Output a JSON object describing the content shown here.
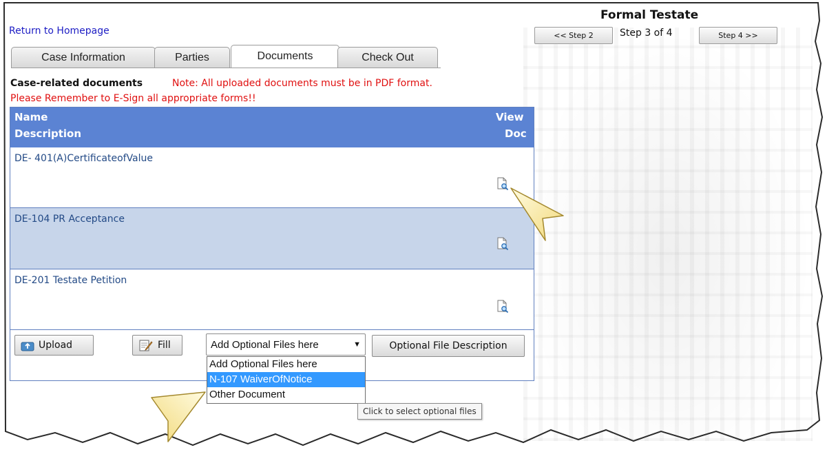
{
  "header": {
    "home_link": "Return to Homepage",
    "page_title": "Formal Testate",
    "prev_step": "<< Step 2",
    "step_indicator": "Step 3 of 4",
    "next_step": "Step 4 >>"
  },
  "tabs": [
    {
      "label": "Case Information"
    },
    {
      "label": "Parties"
    },
    {
      "label": "Documents"
    },
    {
      "label": "Check Out"
    }
  ],
  "intro": {
    "bold": "Case-related documents",
    "note": "Note: All uploaded documents must be in PDF format.",
    "reminder": "Please Remember to E-Sign all appropriate forms!!"
  },
  "table": {
    "col_name": "Name",
    "col_desc": "Description",
    "col_view": "View",
    "col_doc": "Doc",
    "rows": [
      {
        "name": "DE- 401(A)CertificateofValue",
        "icon": "view-document-icon"
      },
      {
        "name": "DE-104 PR Acceptance",
        "icon": "view-document-icon"
      },
      {
        "name": "DE-201 Testate Petition",
        "icon": "view-document-icon"
      }
    ]
  },
  "actions": {
    "upload": "Upload",
    "fill": "Fill",
    "select_value": "Add Optional Files here",
    "optional_desc": "Optional File Description"
  },
  "dropdown": {
    "options": [
      "Add Optional Files here",
      "N-107 WaiverOfNotice",
      "Other Document"
    ],
    "selected_index": 1
  },
  "tooltip": "Click to select optional files",
  "colors": {
    "header_blue": "#5b83d3",
    "alt_row": "#c7d5ea",
    "warning_red": "#e01010",
    "link_blue": "#1c1cc4"
  }
}
